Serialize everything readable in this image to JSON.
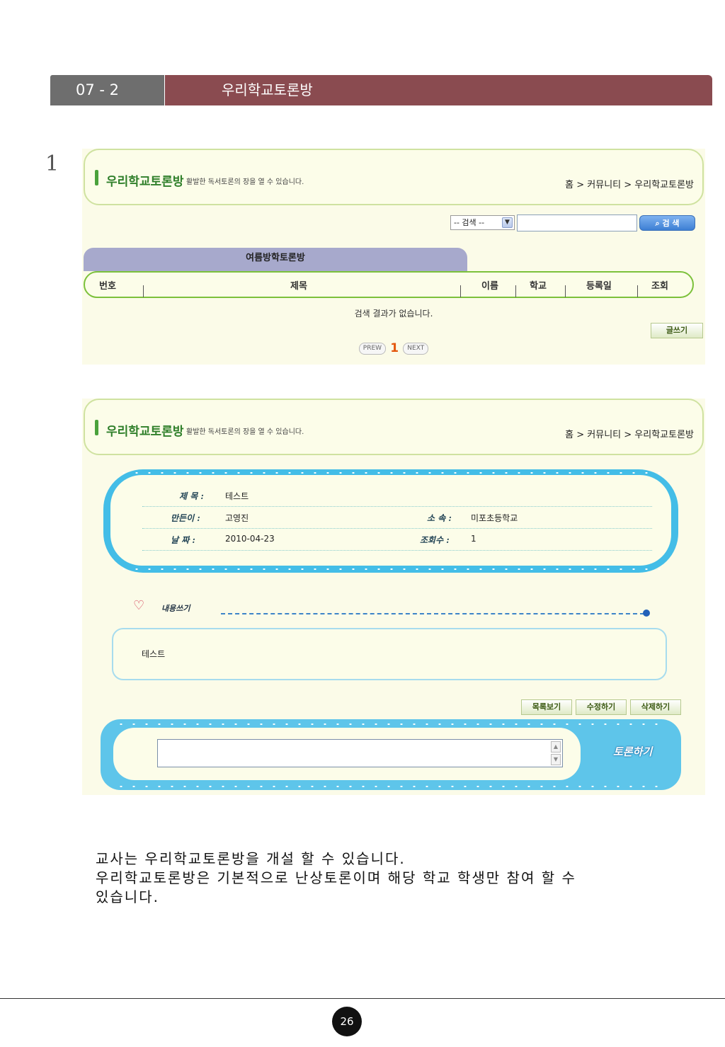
{
  "chapter": {
    "number": "07 - 2",
    "title": "우리학교토론방"
  },
  "step": "1",
  "list_panel": {
    "title": "우리학교토론방",
    "subtitle": "활발한 독서토론의 장을 열 수 있습니다.",
    "breadcrumb": "홈 > 커뮤니티 > 우리학교토론방",
    "search_select": "-- 검색 --",
    "search_value": "",
    "search_button": "검 색",
    "tab": "여름방학토론방",
    "columns": [
      "번호",
      "제목",
      "이름",
      "학교",
      "등록일",
      "조회"
    ],
    "empty_message": "검색 결과가 없습니다.",
    "write_button": "글쓰기",
    "pager": {
      "prev": "PREW",
      "current": "1",
      "next": "NEXT"
    }
  },
  "detail_panel": {
    "title": "우리학교토론방",
    "subtitle": "활발한 독서토론의 장을 열 수 있습니다.",
    "breadcrumb": "홈 > 커뮤니티 > 우리학교토론방",
    "labels": {
      "subject": "제 목 :",
      "author": "만든이 :",
      "affiliation": "소 속 :",
      "date": "날 짜 :",
      "views": "조회수 :"
    },
    "values": {
      "subject": "테스트",
      "author": "고영진",
      "affiliation": "미포초등학교",
      "date": "2010-04-23",
      "views": "1"
    },
    "content_heading": "내용쓰기",
    "content": "테스트",
    "buttons": {
      "list": "목록보기",
      "edit": "수정하기",
      "delete": "삭제하기"
    },
    "comment_value": "",
    "discuss_button": "토론하기"
  },
  "description": [
    "교사는 우리학교토론방을 개설 할 수 있습니다.",
    "우리학교토론방은 기본적으로 난상토론이며 해당 학교 학생만 참여 할 수",
    "있습니다."
  ],
  "page_number": "26"
}
